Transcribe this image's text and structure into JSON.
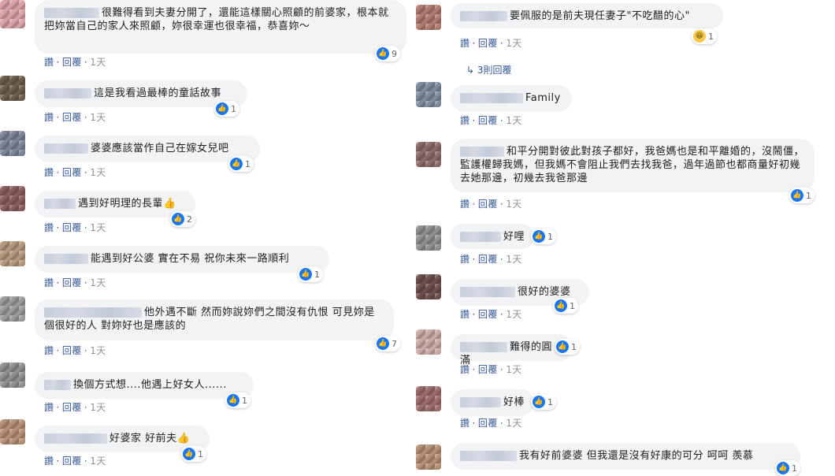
{
  "actions": {
    "like": "讚",
    "reply": "回覆",
    "sep": "·",
    "time": "1天"
  },
  "left": [
    {
      "text": "很難得看到夫妻分開了，還能這樣關心照顧的前婆家，根本就把妳當自己的家人來照顧，妳很幸運也很幸福，恭喜妳～",
      "reactions": "9"
    },
    {
      "text": "這是我看過最棒的童話故事",
      "reactions": "1"
    },
    {
      "text": "婆婆應該當作自己在嫁女兒吧",
      "reactions": "1"
    },
    {
      "text": "遇到好明理的長輩👍",
      "reactions": "2"
    },
    {
      "text": "能遇到好公婆 實在不易 祝你未來一路順利",
      "reactions": "1"
    },
    {
      "text": "他外遇不斷 然而妳說妳們之間沒有仇恨 可見妳是個很好的人 對妳好也是應該的",
      "reactions": "7"
    },
    {
      "text": "換個方式想....他遇上好女人......",
      "reactions": "1"
    },
    {
      "text": "好婆家 好前夫👍",
      "reactions": "1"
    }
  ],
  "right": [
    {
      "text": "要佩服的是前夫現任妻子\"不吃醋的心\"",
      "reactions": "1"
    },
    {
      "replies_link": "3則回覆"
    },
    {
      "text": "Family",
      "reactions": ""
    },
    {
      "text": "和平分開對彼此對孩子都好，我爸媽也是和平離婚的，沒鬧僵，監護權歸我媽，但我媽不會阻止我們去找我爸，過年過節也都商量好初幾去她那邊，初幾去我爸那邊",
      "reactions": "1"
    },
    {
      "text": "好哩",
      "reactions": "1"
    },
    {
      "text": "很好的婆婆",
      "reactions": "1"
    },
    {
      "text": "難得的圓滿",
      "reactions": "1"
    },
    {
      "text": "好棒",
      "reactions": "1"
    },
    {
      "text": "我有好前婆婆 但我還是沒有好康的可分 呵呵 羨慕",
      "reactions": "1"
    }
  ]
}
